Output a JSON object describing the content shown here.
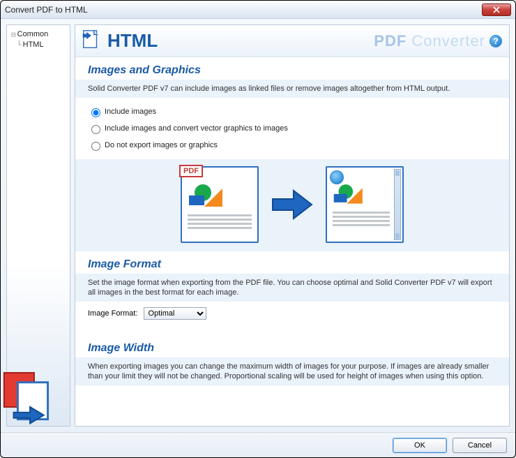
{
  "window": {
    "title": "Convert PDF to HTML"
  },
  "sidebar": {
    "items": [
      {
        "label": "Common"
      },
      {
        "label": "HTML"
      }
    ]
  },
  "header": {
    "title": "HTML",
    "brand_strong": "PDF",
    "brand_light": "Converter"
  },
  "sections": {
    "images": {
      "title": "Images and Graphics",
      "note": "Solid Converter PDF v7 can include images as linked files or remove images altogether from HTML output.",
      "pdf_label": "PDF",
      "options": [
        "Include images",
        "Include images and convert vector graphics to images",
        "Do not export  images or graphics"
      ]
    },
    "format": {
      "title": "Image Format",
      "note": "Set the image format when exporting from the PDF file. You can choose optimal and Solid Converter PDF v7 will export all images in the best format for each image.",
      "label": "Image Format:",
      "value": "Optimal"
    },
    "width": {
      "title": "Image Width",
      "note": "When exporting images you can change the maximum width of images for your purpose. If images are already smaller than your limit they will not be changed. Proportional scaling will be used for height of images when using this option."
    }
  },
  "buttons": {
    "ok": "OK",
    "cancel": "Cancel"
  }
}
